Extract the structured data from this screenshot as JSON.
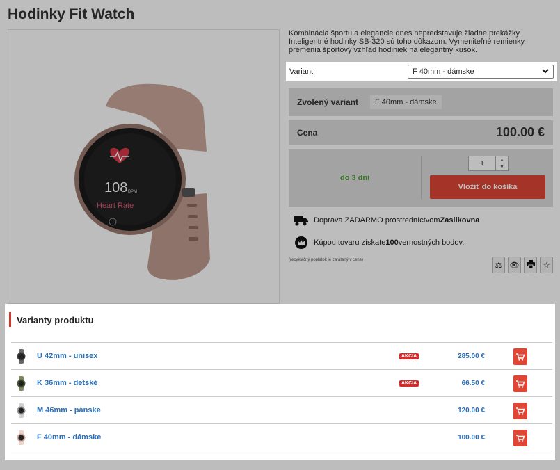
{
  "product": {
    "title": "Hodinky Fit Watch",
    "watch_screen": {
      "bpm_value": "108",
      "bpm_unit": "BPM",
      "label": "Heart Rate"
    },
    "description": "Kombinácia športu a elegancie dnes nepredstavuje žiadne prekážky. Inteligentné hodinky SB-320 sú toho dôkazom. Vymeniteľné remienky premenia športový vzhľad hodiniek na elegantný kúsok.",
    "variant_label": "Variant",
    "variant_selected": "F 40mm - dámske",
    "chosen_label": "Zvolený variant",
    "chosen_value": "F 40mm - dámske",
    "price_label": "Cena",
    "price_value": "100.00 €",
    "availability": "do 3 dní",
    "quantity": "1",
    "cart_button": "Vložiť do košíka",
    "shipping_prefix": "Doprava ZADARMO prostredníctvom ",
    "shipping_carrier": "Zasilkovna",
    "loyalty_prefix": "Kúpou tovaru získate ",
    "loyalty_points": "100",
    "loyalty_suffix": " vernostných bodov.",
    "fine_print": "(recyklačný poplatok je zarátaný v cene)",
    "accent_color": "#e04636",
    "availability_color": "#4a9a2e",
    "link_color": "#2a6fb7"
  },
  "variants_panel": {
    "title": "Varianty produktu",
    "rows": [
      {
        "name": "U 42mm - unisex",
        "badge": "AKCIA",
        "price": "285.00 €",
        "thumb": "dark"
      },
      {
        "name": "K 36mm - detské",
        "badge": "AKCIA",
        "price": "66.50 €",
        "thumb": "green"
      },
      {
        "name": "M 46mm - pánske",
        "badge": "",
        "price": "120.00 €",
        "thumb": "silver"
      },
      {
        "name": "F 40mm - dámske",
        "badge": "",
        "price": "100.00 €",
        "thumb": "pink"
      }
    ]
  },
  "icons": {
    "shipping": "truck-icon",
    "loyalty": "crown-icon",
    "compare": "scales-icon",
    "watchdog": "eye-icon",
    "print": "printer-icon",
    "favorite": "star-icon",
    "cart": "cart-icon"
  }
}
